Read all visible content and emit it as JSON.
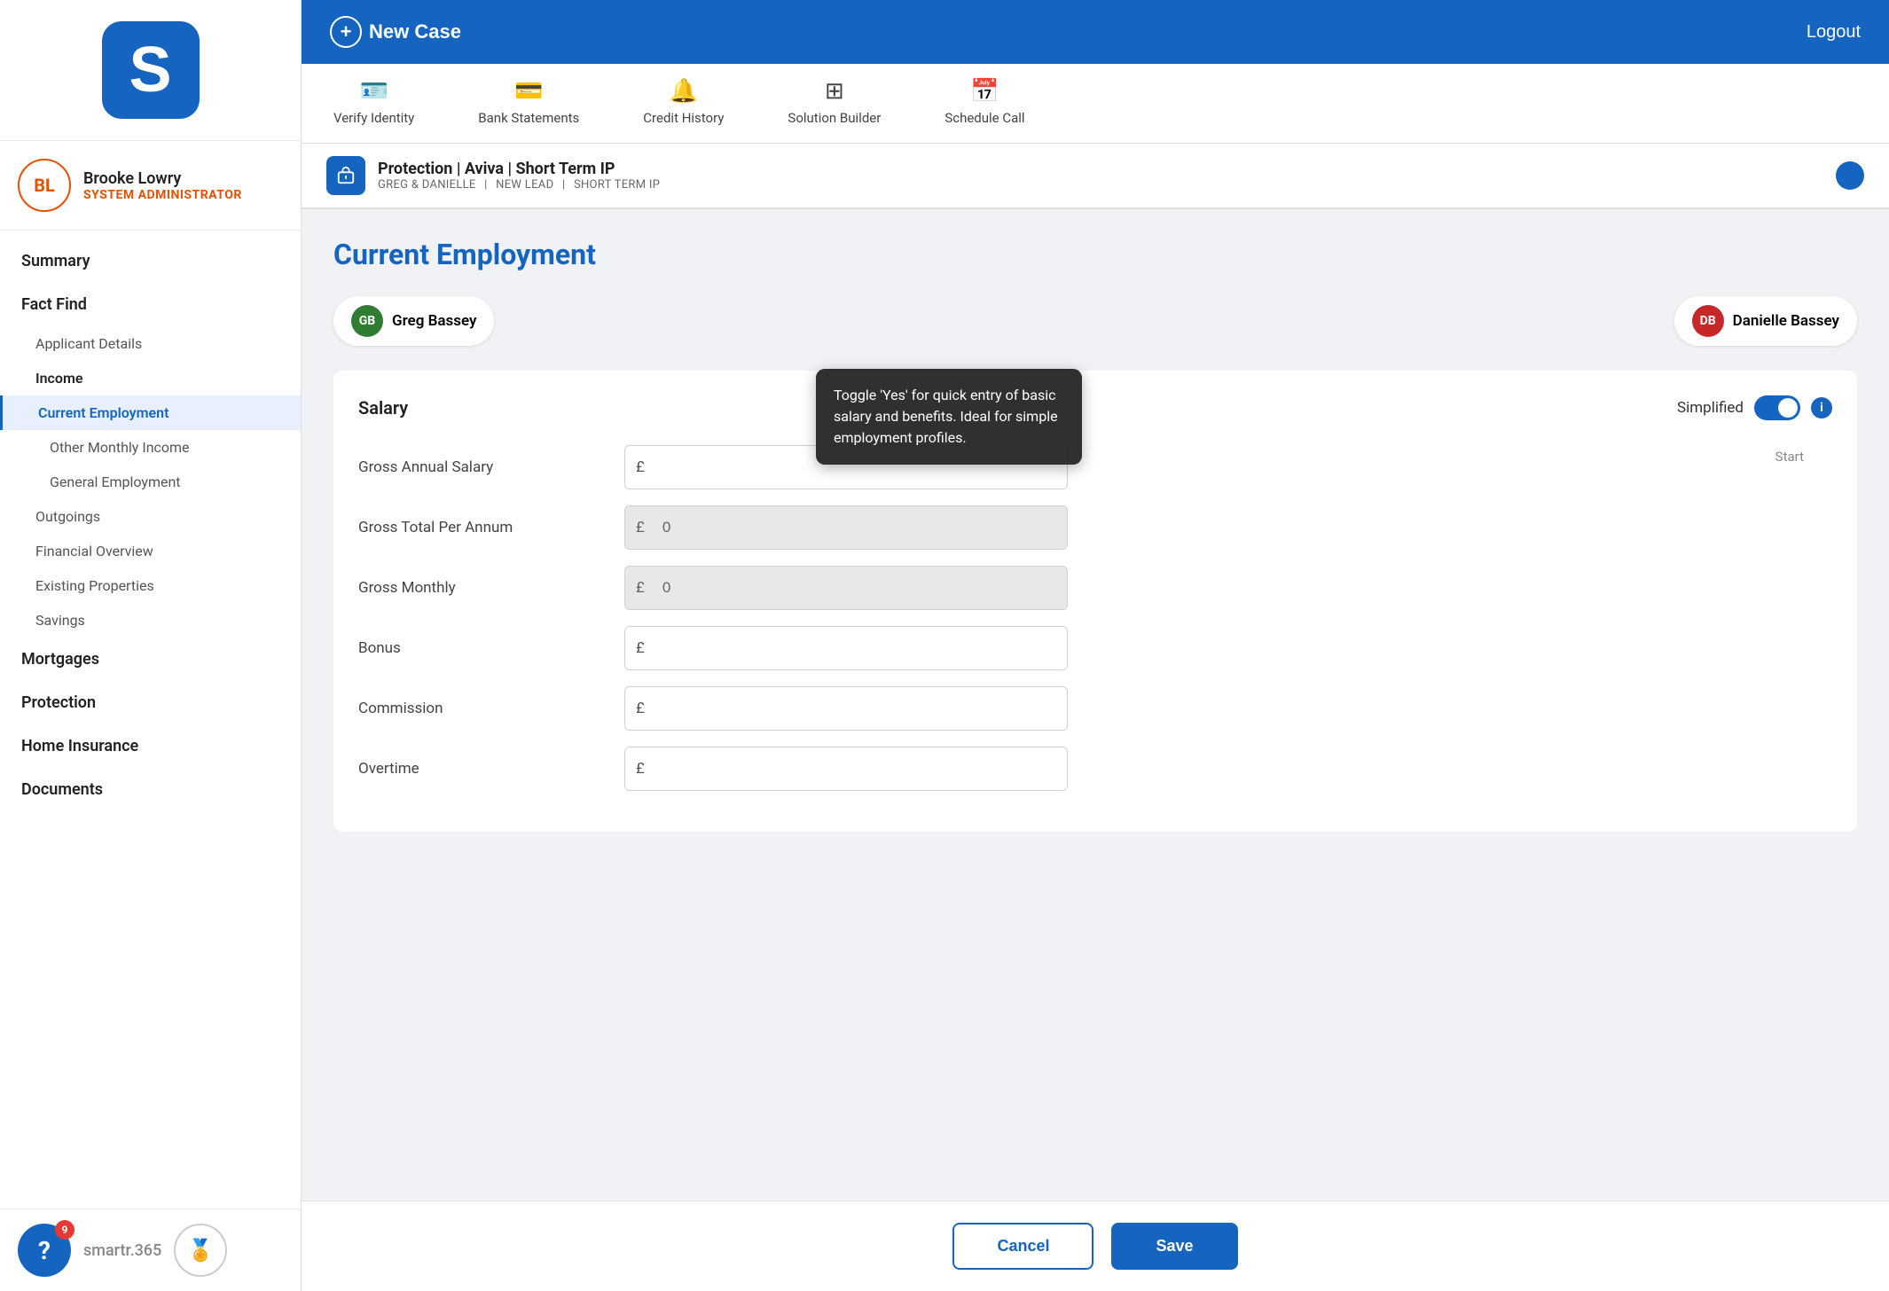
{
  "sidebar": {
    "logo_initials": "S",
    "user": {
      "initials": "BL",
      "name": "Brooke Lowry",
      "role": "SYSTEM ADMINISTRATOR"
    },
    "nav": [
      {
        "id": "summary",
        "label": "Summary",
        "level": "top"
      },
      {
        "id": "fact-find",
        "label": "Fact Find",
        "level": "top"
      },
      {
        "id": "applicant-details",
        "label": "Applicant Details",
        "level": "sub"
      },
      {
        "id": "income",
        "label": "Income",
        "level": "sub-bold"
      },
      {
        "id": "current-employment",
        "label": "Current Employment",
        "level": "sub-active"
      },
      {
        "id": "other-monthly-income",
        "label": "Other Monthly Income",
        "level": "sub-indent"
      },
      {
        "id": "general-employment",
        "label": "General Employment",
        "level": "sub-indent"
      },
      {
        "id": "outgoings",
        "label": "Outgoings",
        "level": "sub"
      },
      {
        "id": "financial-overview",
        "label": "Financial Overview",
        "level": "sub"
      },
      {
        "id": "existing-properties",
        "label": "Existing Properties",
        "level": "sub"
      },
      {
        "id": "savings",
        "label": "Savings",
        "level": "sub"
      },
      {
        "id": "mortgages",
        "label": "Mortgages",
        "level": "top"
      },
      {
        "id": "protection",
        "label": "Protection",
        "level": "top"
      },
      {
        "id": "home-insurance",
        "label": "Home Insurance",
        "level": "top"
      },
      {
        "id": "documents",
        "label": "Documents",
        "level": "top"
      }
    ],
    "footer": {
      "help_badge": "9",
      "brand_name": "artr.365"
    }
  },
  "header": {
    "new_case_label": "New Case",
    "logout_label": "Logout"
  },
  "tabs": [
    {
      "id": "verify-identity",
      "label": "Verify Identity",
      "icon": "🪪"
    },
    {
      "id": "bank-statements",
      "label": "Bank Statements",
      "icon": "💳"
    },
    {
      "id": "credit-history",
      "label": "Credit History",
      "icon": "🔔"
    },
    {
      "id": "solution-builder",
      "label": "Solution Builder",
      "icon": "⊞"
    },
    {
      "id": "schedule-call",
      "label": "Schedule Call",
      "icon": "📅"
    }
  ],
  "case_info": {
    "title": "Protection | Aviva | Short Term IP",
    "meta1": "GREG & DANIELLE",
    "meta2": "NEW LEAD",
    "meta3": "SHORT TERM IP"
  },
  "page": {
    "title": "Current Employment"
  },
  "applicants": [
    {
      "id": "greg",
      "initials": "GB",
      "name": "Greg Bassey",
      "color": "#2e7d32"
    },
    {
      "id": "danielle",
      "initials": "DB",
      "name": "Danielle Bassey",
      "color": "#c62828"
    }
  ],
  "tooltip": {
    "text": "Toggle 'Yes' for quick entry of basic salary and benefits. Ideal for simple employment profiles."
  },
  "form": {
    "salary_section_title": "Salary",
    "simplified_label": "Simplified",
    "info_label": "i",
    "start_label": "Start",
    "fields": [
      {
        "id": "gross-annual-salary",
        "label": "Gross Annual Salary",
        "value": "",
        "placeholder": "",
        "readonly": false,
        "prefix": "£"
      },
      {
        "id": "gross-total-per-annum",
        "label": "Gross Total Per Annum",
        "value": "0",
        "placeholder": "0",
        "readonly": true,
        "prefix": "£"
      },
      {
        "id": "gross-monthly",
        "label": "Gross Monthly",
        "value": "0",
        "placeholder": "0",
        "readonly": true,
        "prefix": "£"
      },
      {
        "id": "bonus",
        "label": "Bonus",
        "value": "",
        "placeholder": "",
        "readonly": false,
        "prefix": "£"
      },
      {
        "id": "commission",
        "label": "Commission",
        "value": "",
        "placeholder": "",
        "readonly": false,
        "prefix": "£"
      },
      {
        "id": "overtime",
        "label": "Overtime",
        "value": "",
        "placeholder": "",
        "readonly": false,
        "prefix": "£"
      }
    ]
  },
  "actions": {
    "cancel_label": "Cancel",
    "save_label": "Save"
  }
}
